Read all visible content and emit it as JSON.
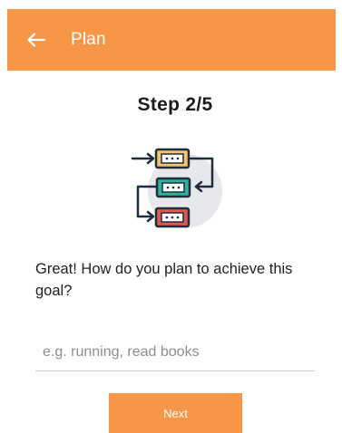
{
  "header": {
    "back_icon": "arrow-left-icon",
    "title": "Plan"
  },
  "step": {
    "label": "Step 2/5"
  },
  "illustration": {
    "icon": "plan-flow-icon"
  },
  "question": {
    "text": "Great! How do you plan to achieve this goal?"
  },
  "plan_input": {
    "value": "",
    "placeholder": "e.g. running, read books"
  },
  "actions": {
    "next_label": "Next"
  },
  "colors": {
    "accent": "#f79646",
    "block_yellow": "#f5c56b",
    "block_teal": "#2bb39a",
    "block_red": "#e8574c",
    "line_navy": "#1f2d3d",
    "circle_bg": "#e6e8ec"
  }
}
